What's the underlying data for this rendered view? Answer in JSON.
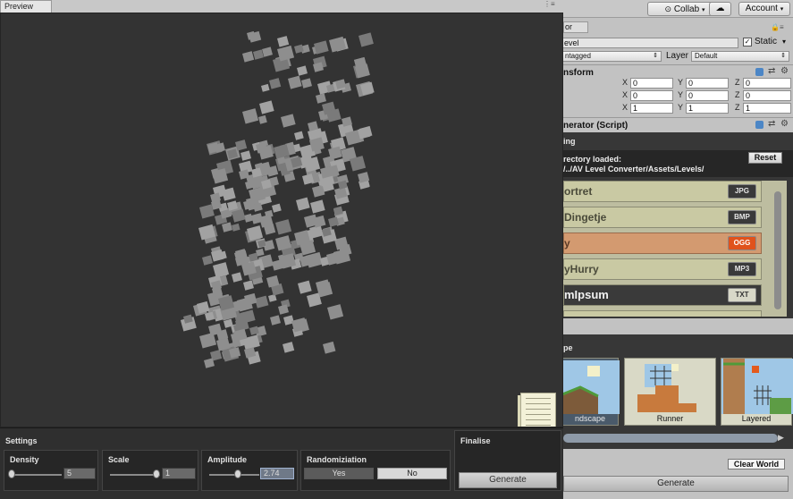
{
  "toolbar": {
    "collab": "Collab",
    "account": "Account",
    "cloud_icon": "cloud-icon"
  },
  "preview": {
    "tab": "Preview"
  },
  "settings": {
    "title": "Settings",
    "density": {
      "label": "Density",
      "value": "5",
      "fraction": 0.05
    },
    "scale": {
      "label": "Scale",
      "value": "1",
      "fraction": 1.0
    },
    "amplitude": {
      "label": "Amplitude",
      "value": "2.74",
      "fraction": 0.6
    },
    "randomization": {
      "label": "Randomiziation",
      "yes": "Yes",
      "no": "No",
      "selected": "No"
    }
  },
  "finalise": {
    "title": "Finalise",
    "button": "Generate"
  },
  "inspector": {
    "tab": "or",
    "name_value": "evel",
    "static_label": "Static",
    "tag_value": "ntagged",
    "layer_label": "Layer",
    "layer_value": "Default",
    "transform": {
      "title": "nsform",
      "position": {
        "x": "0",
        "y": "0",
        "z": "0"
      },
      "rotation": {
        "x": "0",
        "y": "0",
        "z": "0"
      },
      "scale": {
        "x": "1",
        "y": "1",
        "z": "1"
      }
    },
    "script": {
      "title": "nerator (Script)"
    },
    "loading": {
      "header": "ing",
      "line1": "rectory loaded:",
      "line2": "/../AV Level Converter/Assets/Levels/",
      "reset": "Reset"
    },
    "files": [
      {
        "name": "ortret",
        "ext": "JPG",
        "active": false
      },
      {
        "name": "Dingetje",
        "ext": "BMP",
        "active": false
      },
      {
        "name": "y",
        "ext": "OGG",
        "active": true
      },
      {
        "name": "yHurry",
        "ext": "MP3",
        "active": false
      },
      {
        "name": "mIpsum",
        "ext": "TXT",
        "active": false
      }
    ],
    "landscape": {
      "header": "pe",
      "items": [
        {
          "label": "ndscape",
          "selected": true
        },
        {
          "label": "Runner",
          "selected": false
        },
        {
          "label": "Layered",
          "selected": false
        }
      ]
    },
    "clear_world": "Clear World",
    "generate": "Generate"
  }
}
